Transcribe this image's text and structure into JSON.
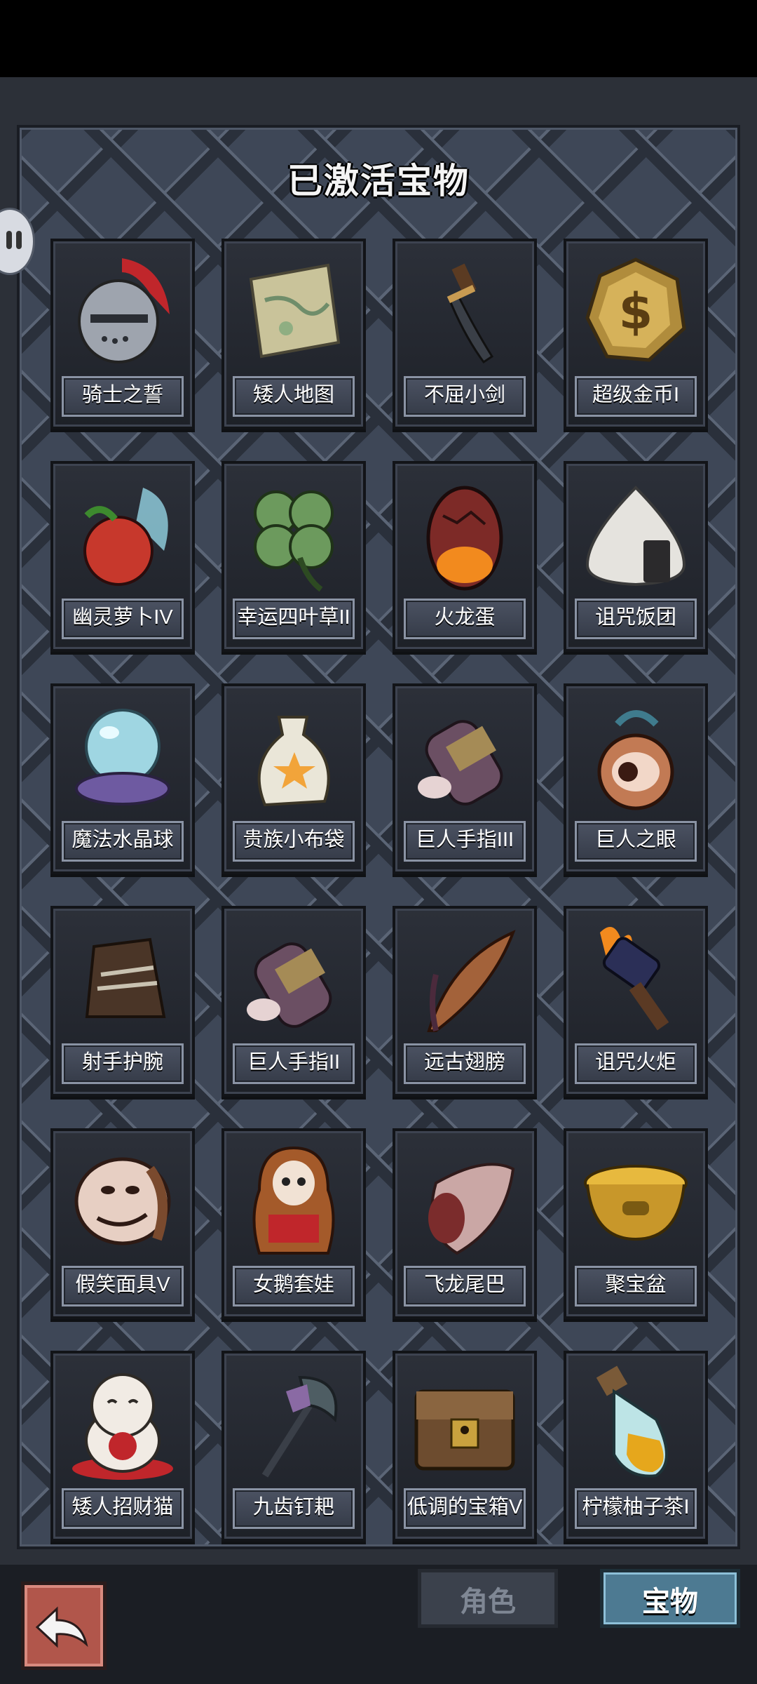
{
  "header": {
    "title": "已激活宝物"
  },
  "treasures": [
    {
      "name": "骑士之誓",
      "icon": "knight-helmet-icon"
    },
    {
      "name": "矮人地图",
      "icon": "map-scroll-icon"
    },
    {
      "name": "不屈小剑",
      "icon": "small-sword-icon"
    },
    {
      "name": "超级金币I",
      "icon": "gold-coin-icon"
    },
    {
      "name": "幽灵萝卜IV",
      "icon": "ghost-radish-icon"
    },
    {
      "name": "幸运四叶草II",
      "icon": "four-leaf-clover-icon"
    },
    {
      "name": "火龙蛋",
      "icon": "fire-dragon-egg-icon"
    },
    {
      "name": "诅咒饭团",
      "icon": "rice-ball-icon"
    },
    {
      "name": "魔法水晶球",
      "icon": "crystal-ball-icon"
    },
    {
      "name": "贵族小布袋",
      "icon": "cloth-bag-icon"
    },
    {
      "name": "巨人手指III",
      "icon": "giant-finger-icon"
    },
    {
      "name": "巨人之眼",
      "icon": "giant-eye-icon"
    },
    {
      "name": "射手护腕",
      "icon": "bracer-icon"
    },
    {
      "name": "巨人手指II",
      "icon": "giant-finger-icon"
    },
    {
      "name": "远古翅膀",
      "icon": "ancient-wing-icon"
    },
    {
      "name": "诅咒火炬",
      "icon": "cursed-torch-icon"
    },
    {
      "name": "假笑面具V",
      "icon": "smile-mask-icon"
    },
    {
      "name": "女鹅套娃",
      "icon": "nesting-doll-icon"
    },
    {
      "name": "飞龙尾巴",
      "icon": "dragon-tail-icon"
    },
    {
      "name": "聚宝盆",
      "icon": "treasure-bowl-icon"
    },
    {
      "name": "矮人招财猫",
      "icon": "lucky-cat-icon"
    },
    {
      "name": "九齿钉耙",
      "icon": "nine-tooth-rake-icon"
    },
    {
      "name": "低调的宝箱V",
      "icon": "treasure-chest-icon"
    },
    {
      "name": "柠檬柚子茶I",
      "icon": "tea-bottle-icon"
    }
  ],
  "tabs": {
    "role": "角色",
    "treasure": "宝物"
  },
  "colors": {
    "panel": "#3e4757",
    "active_tab": "#4d7a92",
    "back_button": "#b1564b"
  }
}
